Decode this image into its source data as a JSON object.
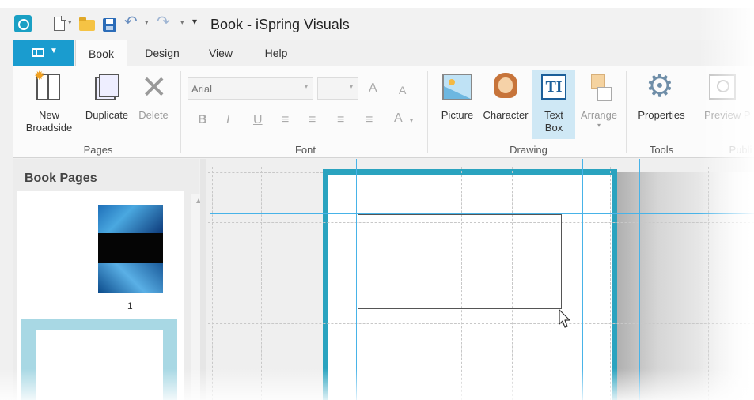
{
  "window": {
    "title": "Book - iSpring Visuals",
    "more_glyph": "▾",
    "undo_glyph": "↶",
    "redo_glyph": "↷",
    "dropdown_glyph": "▾"
  },
  "tabs": [
    {
      "label": "Book",
      "active": true
    },
    {
      "label": "Design",
      "active": false
    },
    {
      "label": "View",
      "active": false
    },
    {
      "label": "Help",
      "active": false
    }
  ],
  "file_tab": {
    "caret": "▼"
  },
  "ribbon": {
    "groups": {
      "pages": "Pages",
      "font": "Font",
      "drawing": "Drawing",
      "tools": "Tools",
      "publish": "Publi"
    },
    "buttons": {
      "new_broadside": [
        "New",
        "Broadside"
      ],
      "duplicate": "Duplicate",
      "delete": "Delete",
      "picture": "Picture",
      "character": "Character",
      "text_box": [
        "Text",
        "Box"
      ],
      "arrange": "Arrange",
      "properties": "Properties",
      "preview": "Preview P"
    },
    "font": {
      "name": "Arial",
      "size": "",
      "grow_glyph": "A",
      "shrink_glyph": "A",
      "bold": "B",
      "italic": "I",
      "underline": "U",
      "color_glyph": "A"
    },
    "icons": {
      "delete_glyph": "✕",
      "gear_glyph": "⚙",
      "textbox_glyph": "TI",
      "star_glyph": "✹"
    }
  },
  "book_pages": {
    "title": "Book Pages",
    "scroll_up_glyph": "▲",
    "pages": [
      {
        "number": "1"
      }
    ]
  },
  "colors": {
    "accent": "#1a9ccf",
    "page_border": "#2aa3bf",
    "guide": "#48b3e8",
    "selected_thumb": "#a8d8e4"
  }
}
